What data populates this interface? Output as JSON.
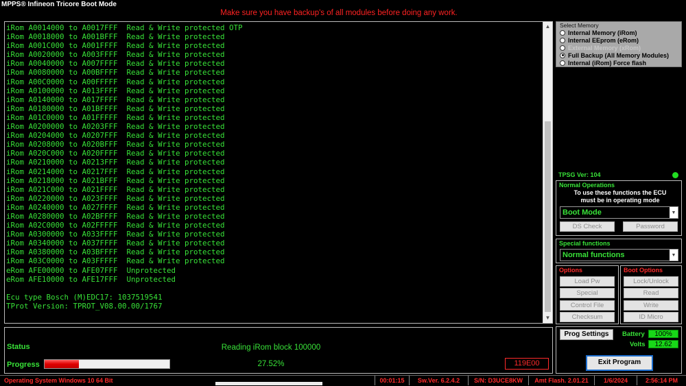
{
  "window": {
    "title": "MPPS® Infineon Tricore Boot Mode"
  },
  "warning": "Make sure you have backup's of all modules before doing any work.",
  "log": {
    "lines": [
      "iRom A0014000 to A0017FFF  Read & Write protected OTP",
      "iRom A0018000 to A001BFFF  Read & Write protected",
      "iRom A001C000 to A001FFFF  Read & Write protected",
      "iRom A0020000 to A003FFFF  Read & Write protected",
      "iRom A0040000 to A007FFFF  Read & Write protected",
      "iRom A0080000 to A00BFFFF  Read & Write protected",
      "iRom A00C0000 to A00FFFFF  Read & Write protected",
      "iRom A0100000 to A013FFFF  Read & Write protected",
      "iRom A0140000 to A017FFFF  Read & Write protected",
      "iRom A0180000 to A01BFFFF  Read & Write protected",
      "iRom A01C0000 to A01FFFFF  Read & Write protected",
      "iRom A0200000 to A0203FFF  Read & Write protected",
      "iRom A0204000 to A0207FFF  Read & Write protected",
      "iRom A0208000 to A020BFFF  Read & Write protected",
      "iRom A020C000 to A020FFFF  Read & Write protected",
      "iRom A0210000 to A0213FFF  Read & Write protected",
      "iRom A0214000 to A0217FFF  Read & Write protected",
      "iRom A0218000 to A021BFFF  Read & Write protected",
      "iRom A021C000 to A021FFFF  Read & Write protected",
      "iRom A0220000 to A023FFFF  Read & Write protected",
      "iRom A0240000 to A027FFFF  Read & Write protected",
      "iRom A0280000 to A02BFFFF  Read & Write protected",
      "iRom A02C0000 to A02FFFFF  Read & Write protected",
      "iRom A0300000 to A033FFFF  Read & Write protected",
      "iRom A0340000 to A037FFFF  Read & Write protected",
      "iRom A0380000 to A03BFFFF  Read & Write protected",
      "iRom A03C0000 to A03FFFFF  Read & Write protected",
      "eRom AFE00000 to AFE07FFF  Unprotected",
      "eRom AFE10000 to AFE17FFF  Unprotected",
      "",
      "Ecu type Bosch (M)EDC17: 1037519541",
      "TProt Version: TPROT_V08.00.00/1767"
    ]
  },
  "status": {
    "status_label": "Status",
    "status_text": "Reading iRom block 100000",
    "progress_label": "Progress",
    "progress_fraction": 0.2752,
    "progress_text": "27.52%",
    "error_code": "119E00"
  },
  "select_memory": {
    "title": "Select Memory",
    "options": [
      {
        "label": "Internal Memory (iRom)",
        "selected": false,
        "enabled": true
      },
      {
        "label": "Internal EEprom (eRom)",
        "selected": false,
        "enabled": true
      },
      {
        "label": "External Memory (xRom)",
        "selected": false,
        "enabled": false
      },
      {
        "label": "Full Backup (All Memory Modules)",
        "selected": true,
        "enabled": true
      },
      {
        "label": "Internal (iRom) Force flash",
        "selected": false,
        "enabled": true
      }
    ]
  },
  "tpsg": {
    "version": "TPSG Ver: 104",
    "indicator_color": "#22dd22"
  },
  "normal_operations": {
    "title": "Normal Operations",
    "note": "To use these functions the ECU must be in operating mode",
    "selected": "Boot Mode",
    "buttons": [
      "DS Check",
      "Password"
    ]
  },
  "special_functions": {
    "title": "Special functions",
    "selected": "Normal functions"
  },
  "options": {
    "title": "Options",
    "buttons": [
      "Load Pw",
      "Special",
      "Control File",
      "Checksum"
    ]
  },
  "boot_options": {
    "title": "Boot Options",
    "buttons": [
      "Lock/Unlock",
      "Read",
      "Write",
      "ID Micro"
    ]
  },
  "prog_settings_label": "Prog Settings",
  "battery": {
    "label": "Battery",
    "value": "100%"
  },
  "volts": {
    "label": "Volts",
    "value": "12.62"
  },
  "exit_label": "Exit Program",
  "statusbar": {
    "os": "Operating System Windows 10 64 Bit",
    "elapsed": "00:01:15",
    "sw_version": "Sw.Ver. 6.2.4.2",
    "serial": "S/N: D3UCE8KW",
    "amt_flash": "Amt Flash. 2.01.21",
    "date": "1/6/2024",
    "time": "2:56:14 PM"
  },
  "colors": {
    "accent_green": "#38e238",
    "alert_red": "#ff2b2b"
  }
}
